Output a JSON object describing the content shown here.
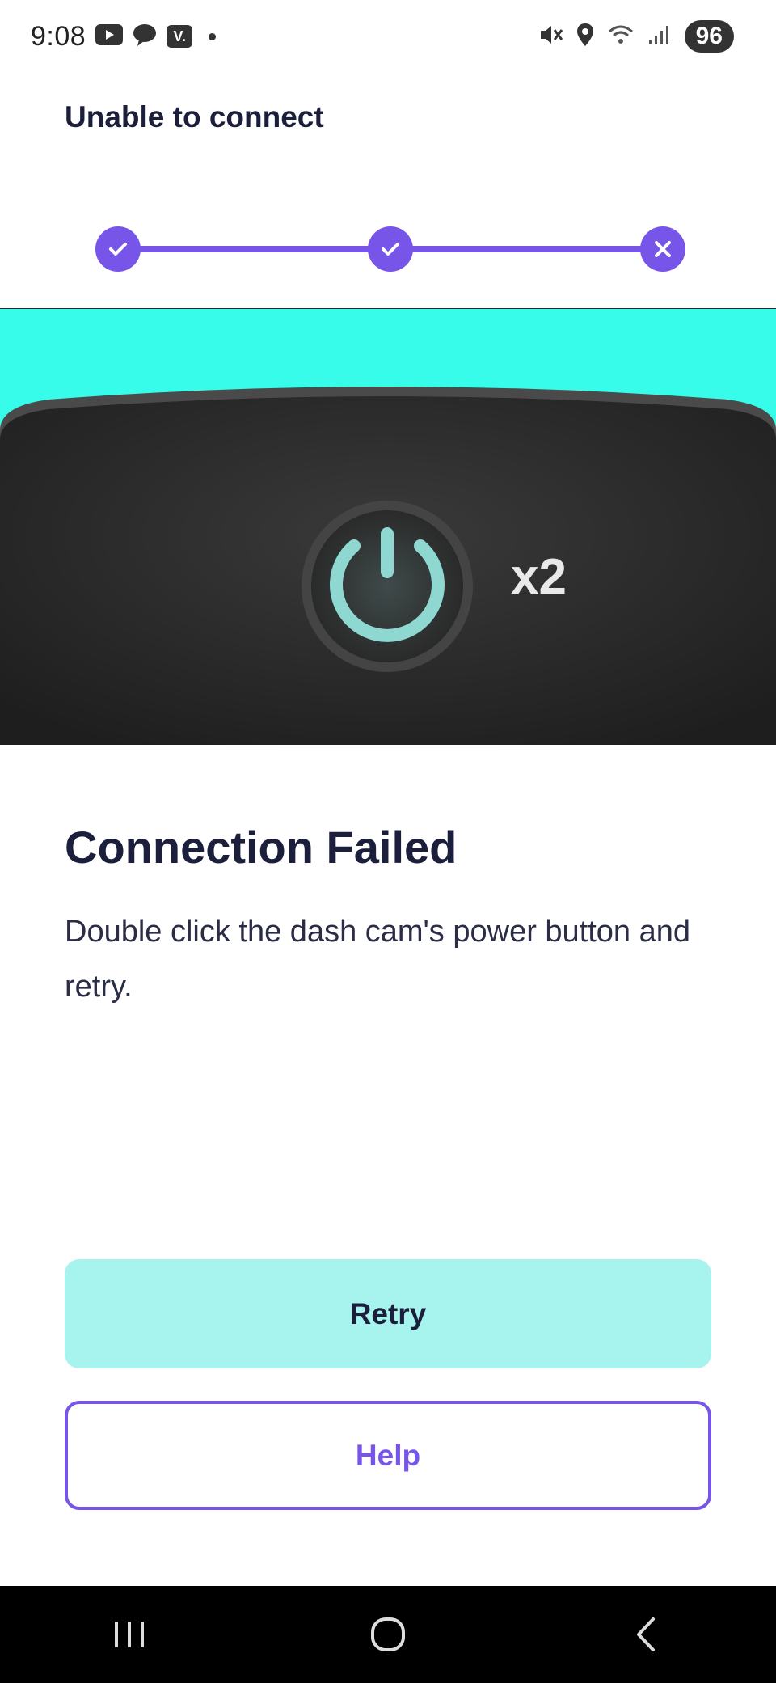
{
  "status_bar": {
    "time": "9:08",
    "app_badge": "V.",
    "battery": "96",
    "icons": [
      "youtube-icon",
      "chat-icon",
      "v-app-icon",
      "mute-icon",
      "location-icon",
      "wifi-icon",
      "signal-icon",
      "battery-icon"
    ]
  },
  "header": {
    "title": "Unable to connect"
  },
  "stepper": {
    "steps": [
      {
        "state": "done",
        "icon": "check-icon"
      },
      {
        "state": "done",
        "icon": "check-icon"
      },
      {
        "state": "failed",
        "icon": "close-icon"
      }
    ],
    "accent": "#7655e8"
  },
  "hero": {
    "multiplier": "x2",
    "background": "#36fce9",
    "icon": "power-icon"
  },
  "content": {
    "heading": "Connection Failed",
    "description": "Double click the dash cam's power button and retry."
  },
  "buttons": {
    "retry": "Retry",
    "help": "Help"
  },
  "nav": {
    "icons": [
      "recents-icon",
      "home-icon",
      "back-icon"
    ]
  }
}
